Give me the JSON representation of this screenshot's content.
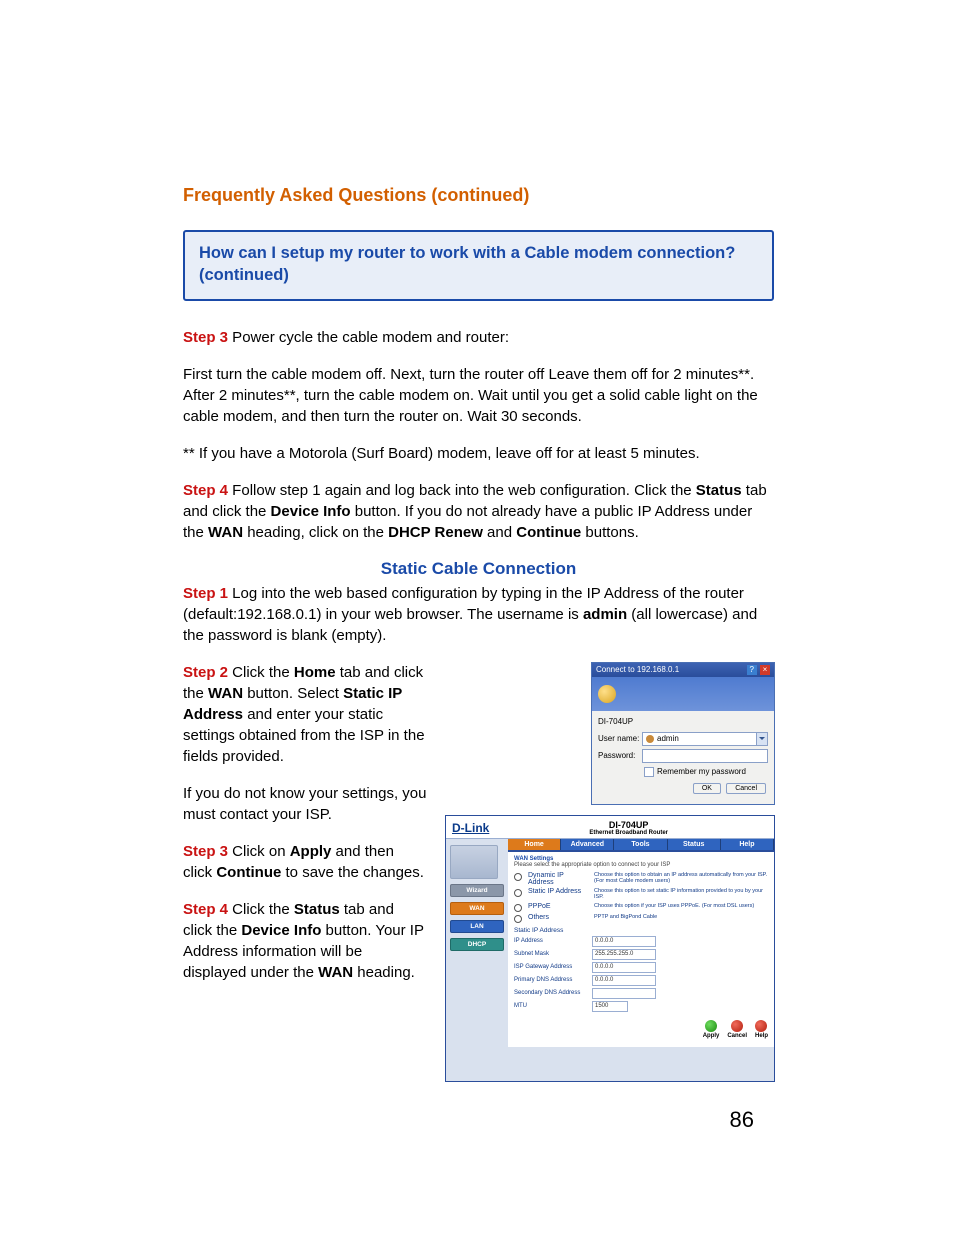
{
  "page_number": "86",
  "section_title": "Frequently Asked Questions (continued)",
  "question_box": "How can I setup my router to work with a Cable modem connection? (continued)",
  "step3_label": "Step 3",
  "step3_text": " Power cycle the cable modem and router:",
  "para_power_cycle": "First turn the cable modem off. Next, turn the router off Leave them off for 2 minutes**. After 2 minutes**, turn the cable modem on.  Wait until you get a solid cable light on the cable modem, and then turn the router on. Wait 30 seconds.",
  "para_footnote": "** If you have a Motorola (Surf Board) modem, leave off for at least 5 minutes.",
  "step4_label": "Step 4",
  "step4_text_a": " Follow step 1 again and log back into the web configuration. Click the ",
  "step4_bold1": "Status",
  "step4_text_b": " tab and click the ",
  "step4_bold2": "Device Info",
  "step4_text_c": " button. If you do not already have a public IP Address under the ",
  "step4_bold3": "WAN",
  "step4_text_d": " heading, click on the ",
  "step4_bold4": "DHCP Renew",
  "step4_text_e": " and ",
  "step4_bold5": "Continue",
  "step4_text_f": " buttons.",
  "sub_title": "Static Cable Connection",
  "sc_step1_label": "Step 1",
  "sc_step1_a": " Log into the web based configuration by typing in the IP Address of the router (default:192.168.0.1) in your web browser. The username is ",
  "sc_step1_bold": "admin",
  "sc_step1_b": " (all lowercase) and the password is blank (empty).",
  "sc_step2_label": "Step 2",
  "sc_step2_a": " Click the ",
  "sc_step2_bold1": "Home",
  "sc_step2_b": " tab and click the ",
  "sc_step2_bold2": "WAN",
  "sc_step2_c": " button. Select ",
  "sc_step2_bold3": "Static IP Address",
  "sc_step2_d": " and enter your static settings obtained from the ISP in the fields provided.",
  "sc_step2_note": "If you do not know your settings, you must contact your ISP.",
  "sc_step3_label": "Step 3",
  "sc_step3_a": " Click on ",
  "sc_step3_bold1": "Apply",
  "sc_step3_b": " and then click ",
  "sc_step3_bold2": "Continue",
  "sc_step3_c": " to save the changes.",
  "sc_step4_label": "Step 4",
  "sc_step4_a": " Click the ",
  "sc_step4_bold1": "Status",
  "sc_step4_b": " tab and click the ",
  "sc_step4_bold2": "Device Info",
  "sc_step4_c": " button. Your IP Address information will be displayed under the ",
  "sc_step4_bold3": "WAN",
  "sc_step4_d": " heading.",
  "login": {
    "title": "Connect to 192.168.0.1",
    "device": "DI-704UP",
    "user_label": "User name:",
    "user_value": "admin",
    "pass_label": "Password:",
    "remember": "Remember my password",
    "ok": "OK",
    "cancel": "Cancel"
  },
  "router": {
    "brand": "D-Link",
    "model": "DI-704UP",
    "model_sub": "Ethernet Broadband Router",
    "side": {
      "wizard": "Wizard",
      "wan": "WAN",
      "lan": "LAN",
      "dhcp": "DHCP"
    },
    "tabs": {
      "home": "Home",
      "advanced": "Advanced",
      "tools": "Tools",
      "status": "Status",
      "help": "Help"
    },
    "hint_hdr": "WAN Settings",
    "hint": "Please select the appropriate option to connect to your ISP",
    "opts": {
      "dyn": "Dynamic IP Address",
      "dyn_d": "Choose this option to obtain an IP address automatically from your ISP. (For most Cable modem users)",
      "stat": "Static IP Address",
      "stat_d": "Choose this option to set static IP information provided to you by your ISP.",
      "pppoe": "PPPoE",
      "pppoe_d": "Choose this option if your ISP uses PPPoE. (For most DSL users)",
      "others": "Others",
      "others_d": "PPTP and BigPond Cable"
    },
    "sec_label": "Static IP Address",
    "fields": {
      "ip_l": "IP Address",
      "ip_v": "0.0.0.0",
      "mask_l": "Subnet Mask",
      "mask_v": "255.255.255.0",
      "gw_l": "ISP Gateway Address",
      "gw_v": "0.0.0.0",
      "dns1_l": "Primary DNS Address",
      "dns1_v": "0.0.0.0",
      "dns2_l": "Secondary DNS Address",
      "dns2_v": "",
      "mtu_l": "MTU",
      "mtu_v": "1500"
    },
    "actions": {
      "apply": "Apply",
      "cancel": "Cancel",
      "help": "Help"
    }
  }
}
